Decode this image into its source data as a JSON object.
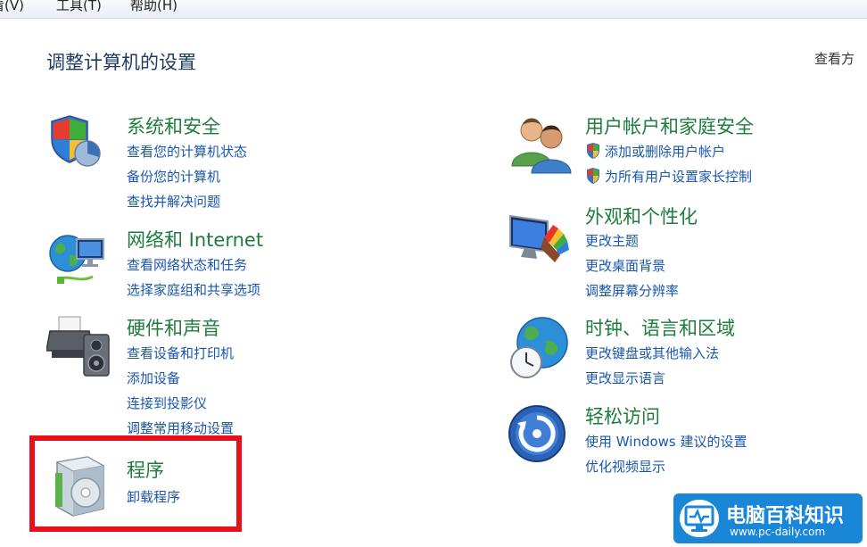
{
  "menubar": {
    "items": [
      "看(V)",
      "工具(T)",
      "帮助(H)"
    ]
  },
  "header": {
    "title": "调整计算机的设置",
    "view_by": "查看方"
  },
  "left_column": [
    {
      "title": "系统和安全",
      "icon": "security-shield-icon",
      "links": [
        "查看您的计算机状态",
        "备份您的计算机",
        "查找并解决问题"
      ]
    },
    {
      "title": "网络和 Internet",
      "icon": "network-globe-icon",
      "links": [
        "查看网络状态和任务",
        "选择家庭组和共享选项"
      ]
    },
    {
      "title": "硬件和声音",
      "icon": "printer-speaker-icon",
      "links": [
        "查看设备和打印机",
        "添加设备",
        "连接到投影仪",
        "调整常用移动设置"
      ]
    },
    {
      "title": "程序",
      "icon": "program-disc-icon",
      "links": [
        "卸载程序"
      ]
    }
  ],
  "right_column": [
    {
      "title": "用户帐户和家庭安全",
      "icon": "users-icon",
      "links": [
        "添加或删除用户帐户",
        "为所有用户设置家长控制"
      ]
    },
    {
      "title": "外观和个性化",
      "icon": "monitor-palette-icon",
      "links": [
        "更改主题",
        "更改桌面背景",
        "调整屏幕分辨率"
      ]
    },
    {
      "title": "时钟、语言和区域",
      "icon": "globe-clock-icon",
      "links": [
        "更改键盘或其他输入法",
        "更改显示语言"
      ]
    },
    {
      "title": "轻松访问",
      "icon": "ease-of-access-icon",
      "links": [
        "使用 Windows 建议的设置",
        "优化视频显示"
      ]
    }
  ],
  "watermark": {
    "title": "电脑百科知识",
    "url": "www.pc-daily.com"
  },
  "colors": {
    "category_green": "#1e7d3d",
    "link_blue": "#1a56b0",
    "highlight_red": "#e8101a"
  }
}
